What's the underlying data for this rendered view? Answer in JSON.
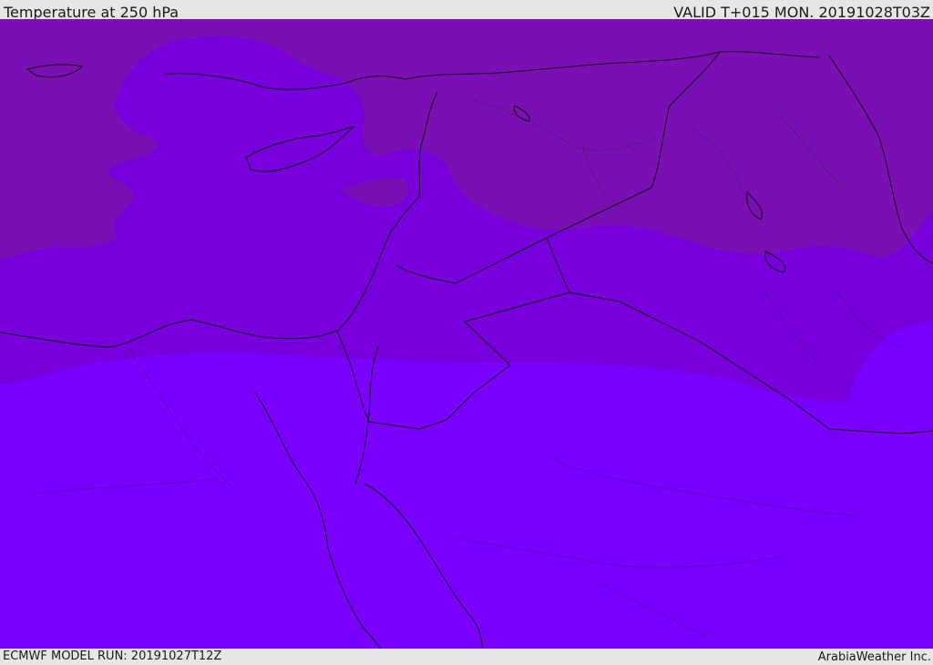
{
  "header": {
    "title": "Temperature at 250 hPa",
    "valid": "VALID T+015 MON. 20191028T03Z"
  },
  "footer": {
    "model_run": "ECMWF MODEL RUN: 20191027T12Z",
    "credit": "ArabiaWeather Inc."
  },
  "map": {
    "field": "temperature",
    "level_hpa": 250,
    "colors": {
      "cold_band": "#7a10b4",
      "mid_band": "#7700dd",
      "warm_band": "#7a00ff",
      "coastline": "#111111",
      "border": "#111111"
    }
  }
}
